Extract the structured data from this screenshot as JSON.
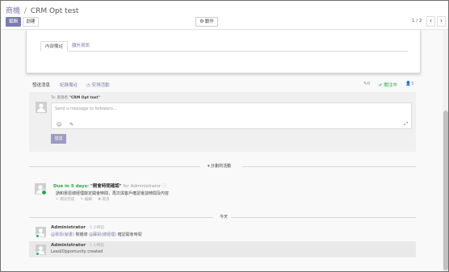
{
  "breadcrumb": {
    "root": "商機",
    "separator": "/",
    "current": "CRM Opt test"
  },
  "toolbar": {
    "edit_label": "編輯",
    "create_label": "創建",
    "action_label": "動作"
  },
  "pager": {
    "value": "1 / 2",
    "prev": "‹",
    "next": "›"
  },
  "sheet": {
    "tabs": [
      {
        "label": "內部備註",
        "active": true
      },
      {
        "label": "額外資訊",
        "active": false
      }
    ]
  },
  "chatter": {
    "tabs": {
      "send_message": "發送消息",
      "log_note": "紀錄備註",
      "schedule_activity": "安排活動"
    },
    "attachments_count": "0",
    "follow_status": "關注中",
    "followers_count": "3",
    "composer": {
      "to_prefix": "To: 跟隨者",
      "to_record": "\"CRM Opt test\"",
      "placeholder": "Send a message to followers...",
      "send_label": "發送"
    },
    "planned_label": "計劃的活動",
    "activity": {
      "due": "Due in 5 days:",
      "title": "\"開會時間確認\"",
      "for_text": "for Administrator",
      "note": "請和晏恩總經理敲定開會時間，再次與客戶確認會談時間及內容",
      "actions": [
        "✔ 標記完成",
        "✎ 編輯",
        "✖ 取消"
      ]
    },
    "today_label": "今天",
    "messages": [
      {
        "author": "Administrator",
        "time": "- 1 小時前",
        "mention1": "@晏恩(秘書)",
        "text1": " 幫雜總 ",
        "mention2": "@蘇凱(總經理)",
        "text2": " 確認開會時間",
        "highlight": false
      },
      {
        "author": "Administrator",
        "time": "- 1 小時前",
        "body": "Lead/Opportunity created",
        "highlight": true
      }
    ]
  },
  "colors": {
    "primary": "#7c7bad",
    "success": "#28a745"
  }
}
